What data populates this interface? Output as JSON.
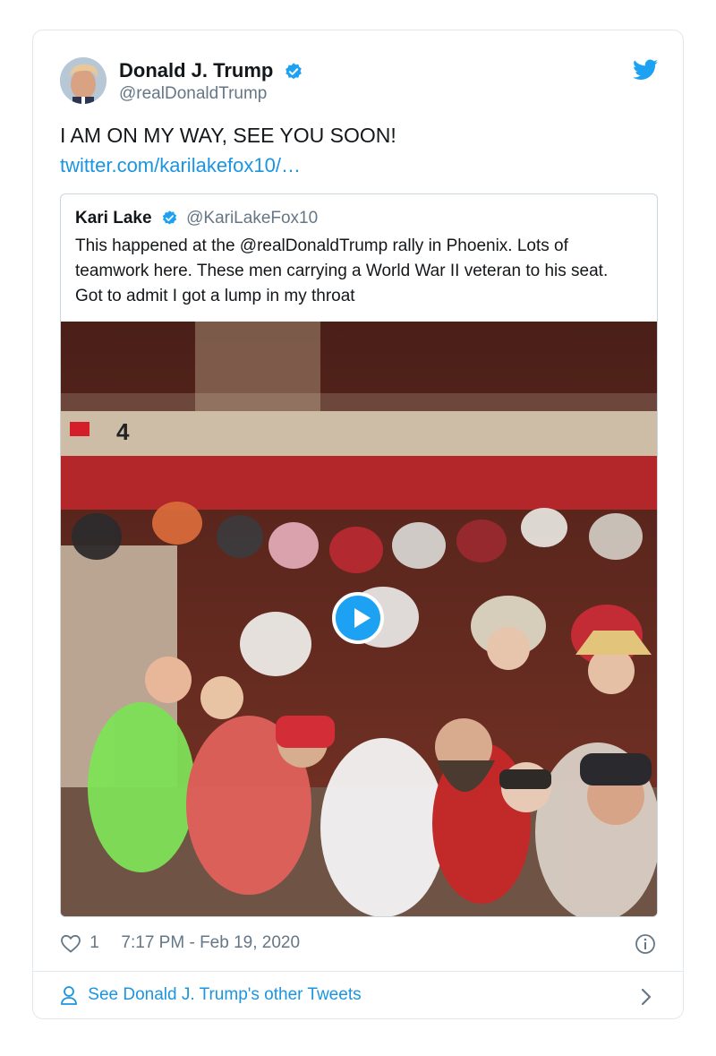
{
  "author": {
    "name": "Donald J. Trump",
    "handle": "@realDonaldTrump",
    "verified": true
  },
  "tweet": {
    "text": "I AM ON MY WAY, SEE YOU SOON!",
    "link": "twitter.com/karilakefox10/…"
  },
  "quoted": {
    "name": "Kari Lake",
    "handle": "@KariLakeFox10",
    "text": "This happened at the @realDonaldTrump rally in Phoenix. Lots of teamwork here. These men carrying a World War II veteran to his seat. Got to admit I got a lump in my throat",
    "media": {
      "type": "video",
      "section_number": "4"
    }
  },
  "meta": {
    "likes": "1",
    "timestamp": "7:17 PM - Feb 19, 2020"
  },
  "footer": {
    "link_label": "See Donald J. Trump's other Tweets"
  },
  "icons": [
    "twitter-bird-icon",
    "verified-badge-icon",
    "heart-icon",
    "info-icon",
    "person-icon",
    "chevron-right-icon",
    "play-icon"
  ],
  "colors": {
    "accent": "#1da1f2",
    "link": "#1b95e0",
    "secondary_text": "#657786",
    "border": "#e1e8ed"
  }
}
